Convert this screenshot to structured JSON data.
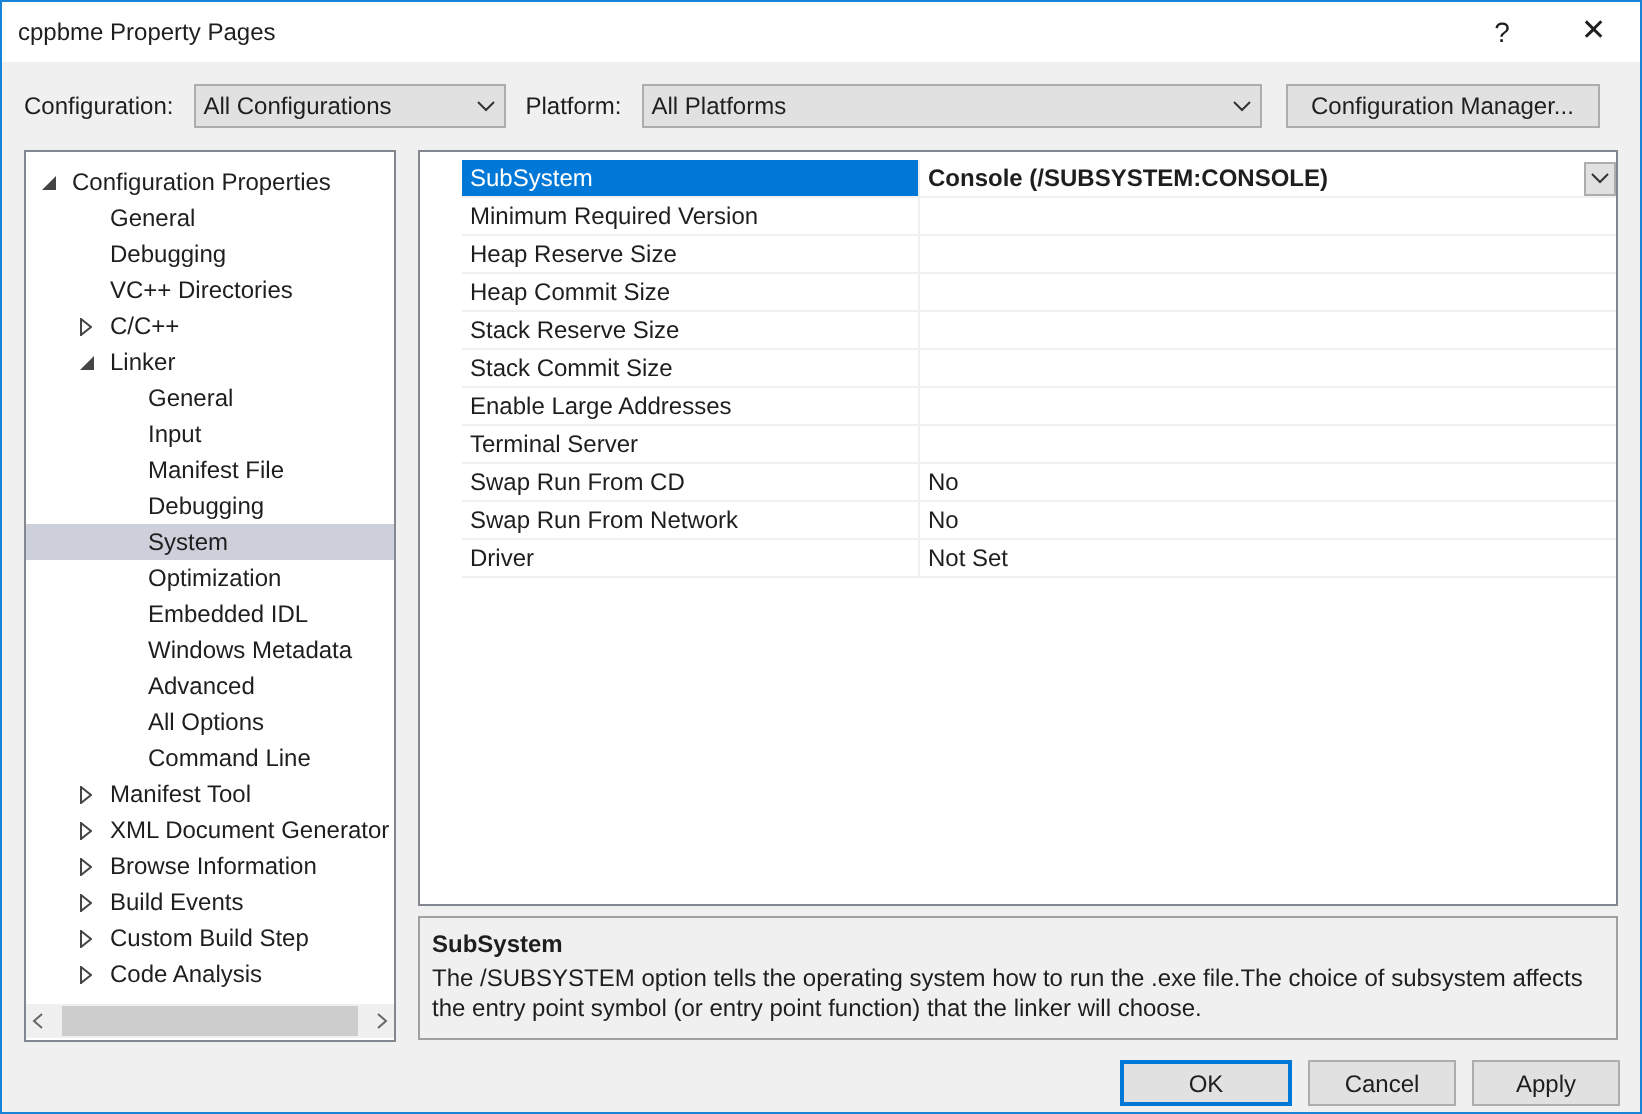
{
  "window": {
    "title": "cppbme Property Pages",
    "help": "?",
    "close": "✕"
  },
  "toolbar": {
    "configuration_label": "Configuration:",
    "configuration": "All Configurations",
    "platform_label": "Platform:",
    "platform": "All Platforms",
    "manager_button": "Configuration Manager..."
  },
  "tree": [
    {
      "label": "Configuration Properties",
      "expanded": true,
      "selected": false,
      "children": [
        {
          "label": "General",
          "selected": false
        },
        {
          "label": "Debugging",
          "selected": false
        },
        {
          "label": "VC++ Directories",
          "selected": false
        },
        {
          "label": "C/C++",
          "expanded": false,
          "selected": false
        },
        {
          "label": "Linker",
          "expanded": true,
          "selected": false,
          "children": [
            {
              "label": "General",
              "selected": false
            },
            {
              "label": "Input",
              "selected": false
            },
            {
              "label": "Manifest File",
              "selected": false
            },
            {
              "label": "Debugging",
              "selected": false
            },
            {
              "label": "System",
              "selected": true
            },
            {
              "label": "Optimization",
              "selected": false
            },
            {
              "label": "Embedded IDL",
              "selected": false
            },
            {
              "label": "Windows Metadata",
              "selected": false
            },
            {
              "label": "Advanced",
              "selected": false
            },
            {
              "label": "All Options",
              "selected": false
            },
            {
              "label": "Command Line",
              "selected": false
            }
          ]
        },
        {
          "label": "Manifest Tool",
          "expanded": false,
          "selected": false
        },
        {
          "label": "XML Document Generator",
          "expanded": false,
          "selected": false
        },
        {
          "label": "Browse Information",
          "expanded": false,
          "selected": false
        },
        {
          "label": "Build Events",
          "expanded": false,
          "selected": false
        },
        {
          "label": "Custom Build Step",
          "expanded": false,
          "selected": false
        },
        {
          "label": "Code Analysis",
          "expanded": false,
          "selected": false
        }
      ]
    }
  ],
  "properties": [
    {
      "name": "SubSystem",
      "value": "Console (/SUBSYSTEM:CONSOLE)",
      "selected": true
    },
    {
      "name": "Minimum Required Version",
      "selected": false
    },
    {
      "name": "Heap Reserve Size",
      "selected": false
    },
    {
      "name": "Heap Commit Size",
      "selected": false
    },
    {
      "name": "Stack Reserve Size",
      "selected": false
    },
    {
      "name": "Stack Commit Size",
      "selected": false
    },
    {
      "name": "Enable Large Addresses",
      "selected": false
    },
    {
      "name": "Terminal Server",
      "selected": false
    },
    {
      "name": "Swap Run From CD",
      "value": "No",
      "selected": false
    },
    {
      "name": "Swap Run From Network",
      "value": "No",
      "selected": false
    },
    {
      "name": "Driver",
      "value": "Not Set",
      "selected": false
    }
  ],
  "description": {
    "title": "SubSystem",
    "text": "The /SUBSYSTEM option tells the operating system how to run the .exe file.The choice of subsystem affects the entry point symbol (or entry point function) that the linker will choose."
  },
  "buttons": [
    {
      "label": "OK",
      "default": true
    },
    {
      "label": "Cancel",
      "default": false
    },
    {
      "label": "Apply",
      "default": false
    }
  ]
}
